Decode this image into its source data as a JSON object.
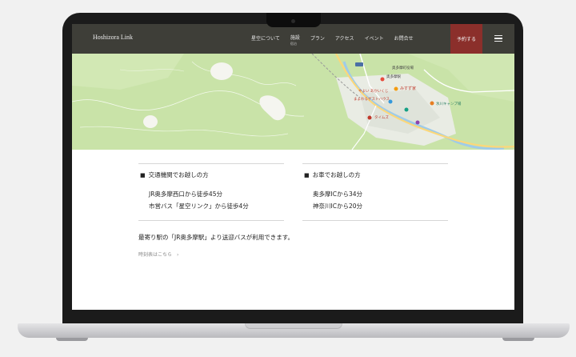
{
  "header": {
    "logo": "Hoshizora Link",
    "nav": [
      {
        "label": "星空について",
        "sub": ""
      },
      {
        "label": "施設",
        "sub": "宿泊"
      },
      {
        "label": "プラン",
        "sub": ""
      },
      {
        "label": "アクセス",
        "sub": ""
      },
      {
        "label": "イベント",
        "sub": ""
      },
      {
        "label": "お問合せ",
        "sub": ""
      }
    ],
    "reserve_label": "予約する",
    "menu_icon": "hamburger-icon"
  },
  "map": {
    "labels": [
      "奥多摩駅",
      "みすず家",
      "やよい あかいくじ",
      "まよわるゲストハウス",
      "タイムズ",
      "氷川キャンプ場",
      "奥多摩町役場"
    ]
  },
  "access": {
    "public": {
      "title": "交通機関でお越しの方",
      "lines": [
        "JR奥多摩西口から徒歩45分",
        "市営バス「星空リンク」から徒歩4分"
      ]
    },
    "car": {
      "title": "お車でお越しの方",
      "lines": [
        "奥多摩ICから34分",
        "神奈川ICから20分"
      ]
    },
    "note": "最寄り駅の「JR奥多摩駅」より送迎バスが利用できます。",
    "timetable_link": "時刻表はこちら　›"
  },
  "colors": {
    "header_bg": "#3e3e38",
    "reserve_bg": "#8b2f2b",
    "map_green": "#c9e3a8"
  }
}
